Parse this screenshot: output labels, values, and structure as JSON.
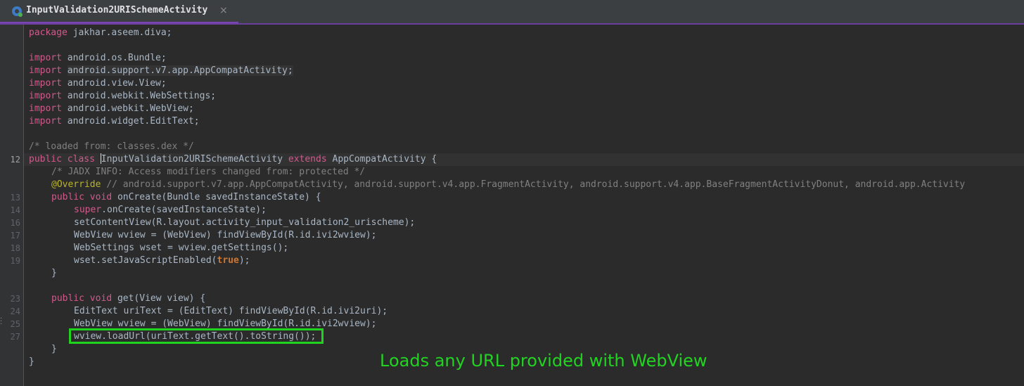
{
  "tab": {
    "title": "InputValidation2URISchemeActivity",
    "close": "×"
  },
  "annotation": "Loads any URL provided with WebView",
  "colors": {
    "keyword": "#cc7832",
    "comment": "#808080",
    "highlight_box": "#1fd31f",
    "annotation": "#22d322"
  },
  "code": {
    "package_line": "jakhar.aseem.diva;",
    "imports": [
      "android.os.Bundle;",
      "android.support.v7.app.AppCompatActivity;",
      "android.view.View;",
      "android.webkit.WebSettings;",
      "android.webkit.WebView;",
      "android.widget.EditText;"
    ],
    "comment_loaded": "/* loaded from: classes.dex */",
    "class_name": "InputValidation2URISchemeActivity",
    "superclass": "AppCompatActivity {",
    "jadx_info": "/* JADX INFO: Access modifiers changed from: protected */",
    "override": "@Override",
    "override_comment": "// android.support.v7.app.AppCompatActivity, android.support.v4.app.FragmentActivity, android.support.v4.app.BaseFragmentActivityDonut, android.app.Activity",
    "oncreate_sig": "onCreate(Bundle savedInstanceState) {",
    "super_call": ".onCreate(savedInstanceState);",
    "set_content": "setContentView(R.layout.activity_input_validation2_urischeme);",
    "wview_decl": "WebView wview = (WebView) findViewById(R.id.ivi2wview);",
    "wset_decl": "WebSettings wset = wview.getSettings();",
    "js_enabled": "wset.setJavaScriptEnabled(",
    "js_true": "true",
    "js_end": ");",
    "close_brace": "}",
    "get_sig": "get(View view) {",
    "uri_text": "EditText uriText = (EditText) findViewById(R.id.ivi2uri);",
    "wview_decl2": "WebView wview = (WebView) findViewById(R.id.ivi2wview);",
    "load_url": "wview.loadUrl(uriText.getText().toString());"
  },
  "keywords": {
    "package": "package",
    "import": "import",
    "public": "public",
    "class": "class",
    "extends": "extends",
    "void": "void",
    "super": "super"
  },
  "line_numbers": {
    "class": "12",
    "oncreate": "13",
    "super": "14",
    "setcontent": "16",
    "wview": "17",
    "wset": "18",
    "js": "19",
    "get": "23",
    "uritext": "24",
    "wview2": "25",
    "loadurl": "27"
  }
}
